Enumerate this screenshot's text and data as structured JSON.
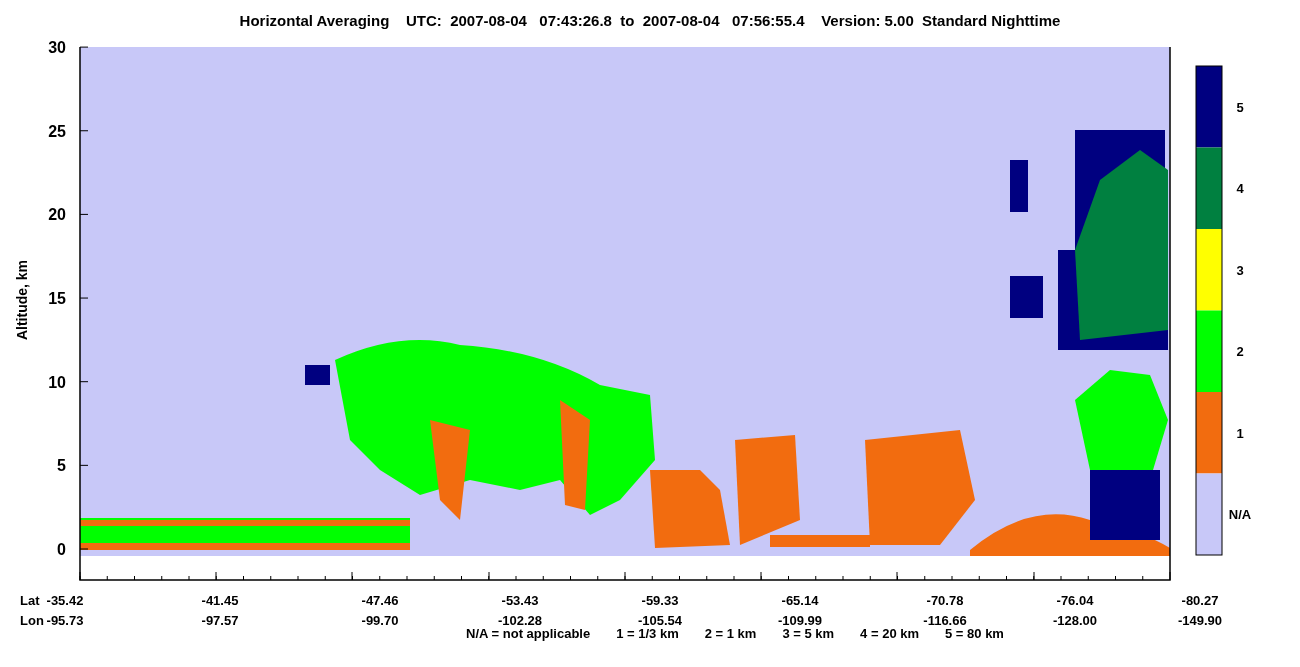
{
  "title": "Horizontal Averaging    UTC:  2007-08-04   07:43:26.8  to  2007-08-04   07:56:55.4    Version: 5.00  Standard Nighttime",
  "y_axis": {
    "label": "Altitude, km",
    "ticks": [
      "30",
      "25",
      "20",
      "15",
      "10",
      "5",
      "0"
    ]
  },
  "x_axis": {
    "row_labels": [
      "Lat",
      "Lon"
    ],
    "ticks": [
      {
        "lat": "-35.42",
        "lon": "-95.73"
      },
      {
        "lat": "-41.45",
        "lon": "-97.57"
      },
      {
        "lat": "-47.46",
        "lon": "-99.70"
      },
      {
        "lat": "-53.43",
        "lon": "-102.28"
      },
      {
        "lat": "-59.33",
        "lon": "-105.54"
      },
      {
        "lat": "-65.14",
        "lon": "-109.99"
      },
      {
        "lat": "-70.78",
        "lon": "-116.66"
      },
      {
        "lat": "-76.04",
        "lon": "-128.00"
      },
      {
        "lat": "-80.27",
        "lon": "-149.90"
      }
    ]
  },
  "colorbar": [
    {
      "label": "5",
      "color": "#000080"
    },
    {
      "label": "4",
      "color": "#008040"
    },
    {
      "label": "3",
      "color": "#ffff00"
    },
    {
      "label": "2",
      "color": "#00ff00"
    },
    {
      "label": "1",
      "color": "#f26c0f"
    },
    {
      "label": "N/A",
      "color": "#c8c8f8"
    }
  ],
  "legend": [
    "N/A = not applicable",
    "1 = 1/3 km",
    "2 = 1 km",
    "3 = 5 km",
    "4 = 20 km",
    "5 = 80 km"
  ]
}
